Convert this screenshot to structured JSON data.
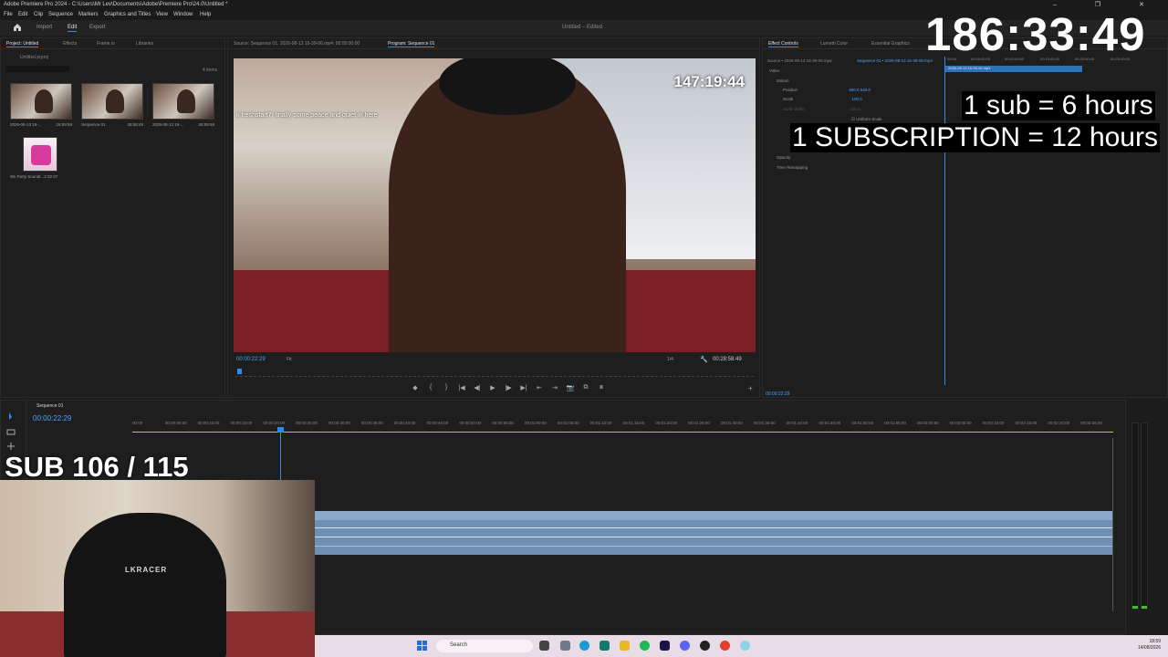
{
  "window": {
    "title": "Adobe Premiere Pro 2024 - C:\\Users\\Mr Lev\\Documents\\Adobe\\Premiere Pro\\24.0\\Untitled *",
    "controls": "–  ❐  ✕"
  },
  "menu": [
    "File",
    "Edit",
    "Clip",
    "Sequence",
    "Markers",
    "Graphics and Titles",
    "View",
    "Window",
    "Help"
  ],
  "workspace": {
    "tabs": [
      "Import",
      "Edit",
      "Export"
    ],
    "active": "Edit",
    "document": "Untitled – Edited"
  },
  "project": {
    "tabs": [
      "Project: Untitled",
      "Effects",
      "Frame.io",
      "Libraries"
    ],
    "file": "Untitled.prproj",
    "count": "4 items",
    "items": [
      {
        "name": "2026-08-13 16-...",
        "duration": "28:59:58"
      },
      {
        "name": "Sequence 01",
        "duration": "28:58:49"
      },
      {
        "name": "2026-08-13 16-...",
        "duration": "28:59:58"
      },
      {
        "name": "Wii Party Soundt...",
        "duration": "2:32:07"
      }
    ]
  },
  "monitor": {
    "source_tab": "Source: Sequence 01: 2026-08-13 16-39-06.mp4: 00:00:00:00",
    "program_tab": "Program: Sequence 01",
    "overlay_timer": "147:19:44",
    "chat_line": "k freshstart7: finally some peace and quiet in here",
    "current_time": "00:00:22:29",
    "fit": "Fit",
    "resolution": "1/4",
    "duration": "00:28:58:49",
    "transport": [
      "◆",
      "{",
      "}",
      "|◀",
      "◀|",
      "▶",
      "|▶",
      "▶|",
      "⇤",
      "⇥",
      "📷",
      "⧉",
      "⧈"
    ]
  },
  "effects": {
    "tabs": [
      "Effect Controls",
      "Lumetri Color",
      "Essential Graphics"
    ],
    "source": "Source • 2026-08-13 16-39-06.mp4",
    "sequence": "Sequence 01 • 2026-08-13 16-39-06.mp4",
    "section": "Video",
    "rows": [
      {
        "label": "Motion",
        "value": ""
      },
      {
        "label": "Position",
        "value": "960.0     540.0"
      },
      {
        "label": "Scale",
        "value": "100.0"
      },
      {
        "label": "Scale Width",
        "value": "100.0"
      },
      {
        "label": "Uniform Scale",
        "value": ""
      },
      {
        "label": "Opacity",
        "value": ""
      },
      {
        "label": "Time Remapping",
        "value": ""
      }
    ],
    "clip_label": "2026-08-13 16-39-06.mp4",
    "ruler": [
      "00:00",
      "00:05:00:00",
      "00:10:00:00",
      "00:15:00:00",
      "00:20:00:00",
      "00:25:00:00"
    ],
    "time": "00:00:22:29"
  },
  "overlays": {
    "big_timer": "186:33:49",
    "sub_rate": "1 sub = 6 hours",
    "subscription_rate": "1 SUBSCRIPTION = 12 hours",
    "sub_count": "SUB 106 / 115"
  },
  "timeline": {
    "sequence_tab": "Sequence 01",
    "current_time": "00:00:22:29",
    "ruler": [
      "00:00",
      "00:00:05:00",
      "00:00:10:00",
      "00:00:15:00",
      "00:00:20:00",
      "00:00:25:00",
      "00:00:30:00",
      "00:00:35:00",
      "00:00:40:00",
      "00:00:45:00",
      "00:00:50:00",
      "00:00:55:00",
      "00:01:00:00",
      "00:01:05:00",
      "00:01:10:00",
      "00:01:15:00",
      "00:01:20:00",
      "00:01:25:00",
      "00:01:30:00",
      "00:01:35:00",
      "00:01:40:00",
      "00:01:45:00",
      "00:01:50:00",
      "00:01:55:00",
      "00:02:00:00",
      "00:02:05:00",
      "00:02:10:00",
      "00:02:15:00",
      "00:02:20:00",
      "00:02:25:00"
    ]
  },
  "webcam": {
    "brand": "LKRACER"
  },
  "taskbar": {
    "search": "Search",
    "time": "18:59",
    "date": "14/08/2026"
  }
}
